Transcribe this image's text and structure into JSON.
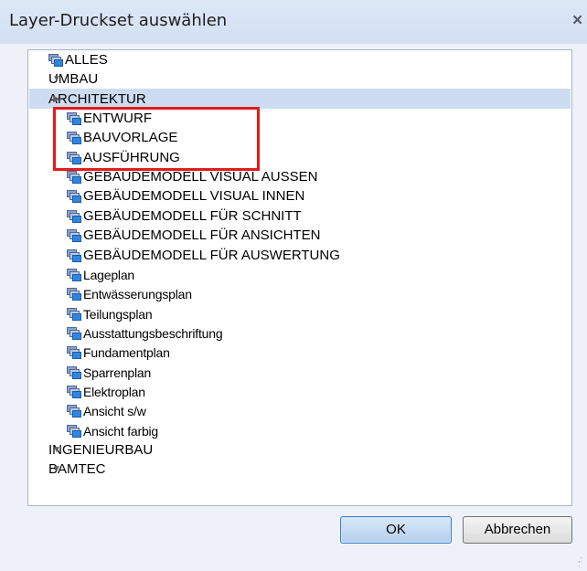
{
  "window": {
    "title": "Layer-Druckset auswählen",
    "close_glyph": "×"
  },
  "tree": {
    "selected_item": "ARCHITEKTUR",
    "items": [
      {
        "label": "ALLES",
        "level": 1,
        "icon": "layer-set-icon",
        "expander": "none"
      },
      {
        "label": "UMBAU",
        "level": 0,
        "icon": "none",
        "expander": "expanded"
      },
      {
        "label": "ARCHITEKTUR",
        "level": 0,
        "icon": "none",
        "expander": "collapsed"
      },
      {
        "label": "ENTWURF",
        "level": 2,
        "icon": "layer-set-icon",
        "expander": "none"
      },
      {
        "label": "BAUVORLAGE",
        "level": 2,
        "icon": "layer-set-icon",
        "expander": "none"
      },
      {
        "label": "AUSFÜHRUNG",
        "level": 2,
        "icon": "layer-set-icon",
        "expander": "none"
      },
      {
        "label": "GEBÄUDEMODELL VISUAL AUSSEN",
        "level": 2,
        "icon": "layer-set-icon",
        "expander": "none"
      },
      {
        "label": "GEBÄUDEMODELL VISUAL INNEN",
        "level": 2,
        "icon": "layer-set-icon",
        "expander": "none"
      },
      {
        "label": "GEBÄUDEMODELL FÜR SCHNITT",
        "level": 2,
        "icon": "layer-set-icon",
        "expander": "none"
      },
      {
        "label": "GEBÄUDEMODELL FÜR ANSICHTEN",
        "level": 2,
        "icon": "layer-set-icon",
        "expander": "none"
      },
      {
        "label": "GEBÄUDEMODELL FÜR AUSWERTUNG",
        "level": 2,
        "icon": "layer-set-icon",
        "expander": "none"
      },
      {
        "label": "Lageplan",
        "level": 2,
        "icon": "layer-set-icon",
        "expander": "none"
      },
      {
        "label": "Entwässerungsplan",
        "level": 2,
        "icon": "layer-set-icon",
        "expander": "none"
      },
      {
        "label": "Teilungsplan",
        "level": 2,
        "icon": "layer-set-icon",
        "expander": "none"
      },
      {
        "label": "Ausstattungsbeschriftung",
        "level": 2,
        "icon": "layer-set-icon",
        "expander": "none"
      },
      {
        "label": "Fundamentplan",
        "level": 2,
        "icon": "layer-set-icon",
        "expander": "none"
      },
      {
        "label": "Sparrenplan",
        "level": 2,
        "icon": "layer-set-icon",
        "expander": "none"
      },
      {
        "label": "Elektroplan",
        "level": 2,
        "icon": "layer-set-icon",
        "expander": "none"
      },
      {
        "label": "Ansicht s/w",
        "level": 2,
        "icon": "layer-set-icon",
        "expander": "none"
      },
      {
        "label": "Ansicht farbig",
        "level": 2,
        "icon": "layer-set-icon",
        "expander": "none"
      },
      {
        "label": "INGENIEURBAU",
        "level": 0,
        "icon": "none",
        "expander": "expanded"
      },
      {
        "label": "BAMTEC",
        "level": 0,
        "icon": "none",
        "expander": "expanded"
      }
    ]
  },
  "buttons": {
    "ok_label": "OK",
    "cancel_label": "Abbrechen"
  },
  "colors": {
    "selection": "#cddcf1",
    "highlight_box": "#e21b1b",
    "icon_accent": "#2f86e0"
  }
}
